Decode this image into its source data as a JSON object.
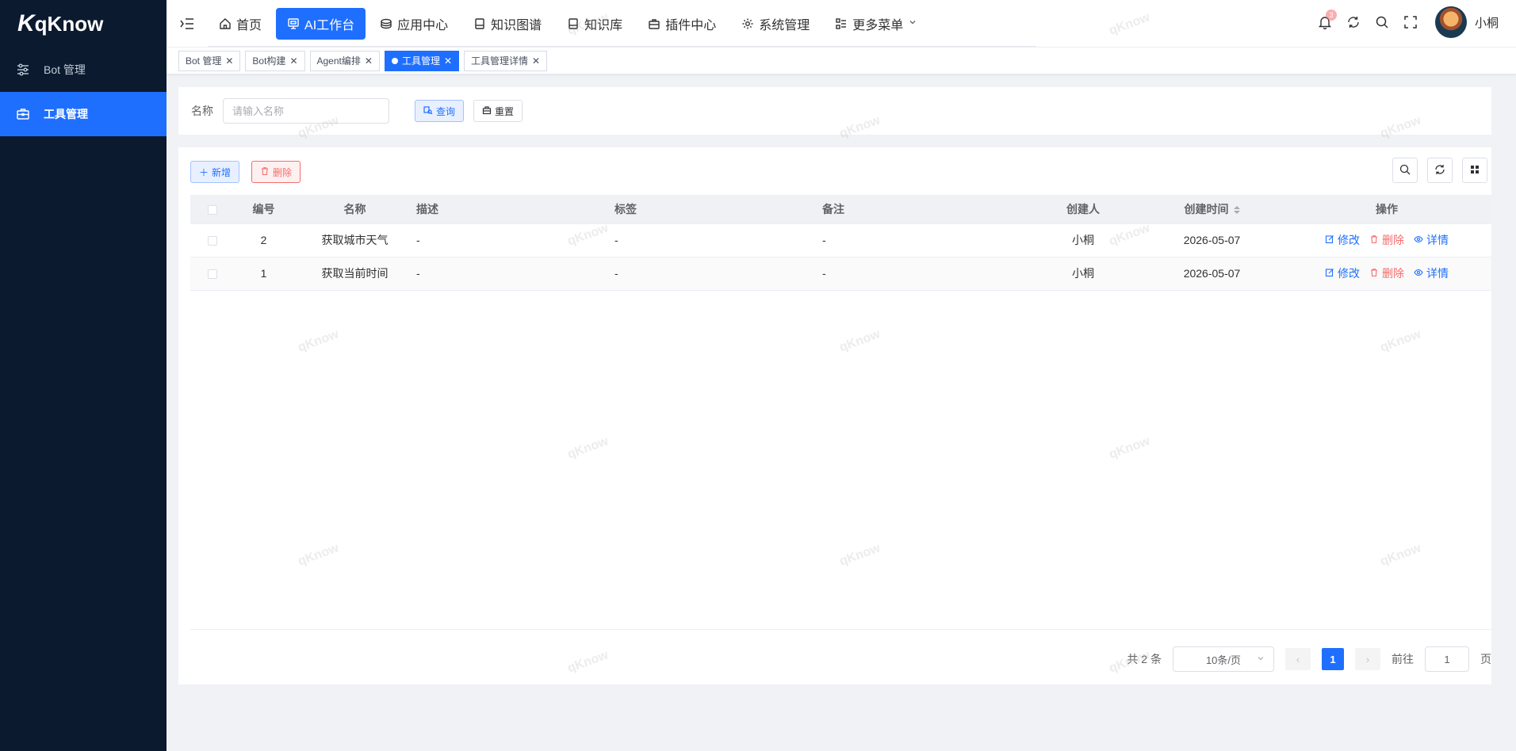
{
  "app": {
    "logo_mark": "K",
    "logo_text": "qKnow"
  },
  "sidebar": {
    "items": [
      {
        "label": "Bot 管理",
        "icon": "sliders-icon",
        "active": false
      },
      {
        "label": "工具管理",
        "icon": "toolbox-icon",
        "active": true
      }
    ]
  },
  "nav": {
    "items": [
      {
        "label": "首页",
        "icon": "home-icon"
      },
      {
        "label": "AI工作台",
        "icon": "monitor-icon",
        "active": true
      },
      {
        "label": "应用中心",
        "icon": "app-icon"
      },
      {
        "label": "知识图谱",
        "icon": "book-icon"
      },
      {
        "label": "知识库",
        "icon": "book-icon"
      },
      {
        "label": "插件中心",
        "icon": "briefcase-icon"
      },
      {
        "label": "系统管理",
        "icon": "gear-icon"
      },
      {
        "label": "更多菜单",
        "icon": "grid-icon"
      }
    ]
  },
  "header": {
    "username": "小桐",
    "notification_count": "3"
  },
  "tags": [
    {
      "label": "Bot 管理",
      "active": false
    },
    {
      "label": "Bot构建",
      "active": false
    },
    {
      "label": "Agent编排",
      "active": false
    },
    {
      "label": "工具管理",
      "active": true
    },
    {
      "label": "工具管理详情",
      "active": false
    }
  ],
  "search": {
    "label": "名称",
    "placeholder": "请输入名称",
    "query_label": "查询",
    "reset_label": "重置"
  },
  "toolbar": {
    "add_label": "新增",
    "delete_label": "删除"
  },
  "table": {
    "columns": [
      "编号",
      "名称",
      "描述",
      "标签",
      "备注",
      "创建人",
      "创建时间",
      "操作"
    ],
    "rows": [
      {
        "id": "2",
        "name": "获取城市天气",
        "desc": "-",
        "tags": "-",
        "remark": "-",
        "creator": "小桐",
        "created": "2026-05-07"
      },
      {
        "id": "1",
        "name": "获取当前时间",
        "desc": "-",
        "tags": "-",
        "remark": "-",
        "creator": "小桐",
        "created": "2026-05-07"
      }
    ],
    "ops": {
      "edit": "修改",
      "delete": "删除",
      "detail": "详情"
    }
  },
  "pagination": {
    "total_text": "共 2 条",
    "page_size": "10条/页",
    "current_page": "1",
    "goto_label": "前往",
    "goto_value": "1",
    "page_suffix": "页"
  },
  "watermark": "qKnow",
  "colors": {
    "primary": "#1f6fff",
    "sidebar_bg": "#0b1a2e",
    "danger": "#f56c6c"
  }
}
